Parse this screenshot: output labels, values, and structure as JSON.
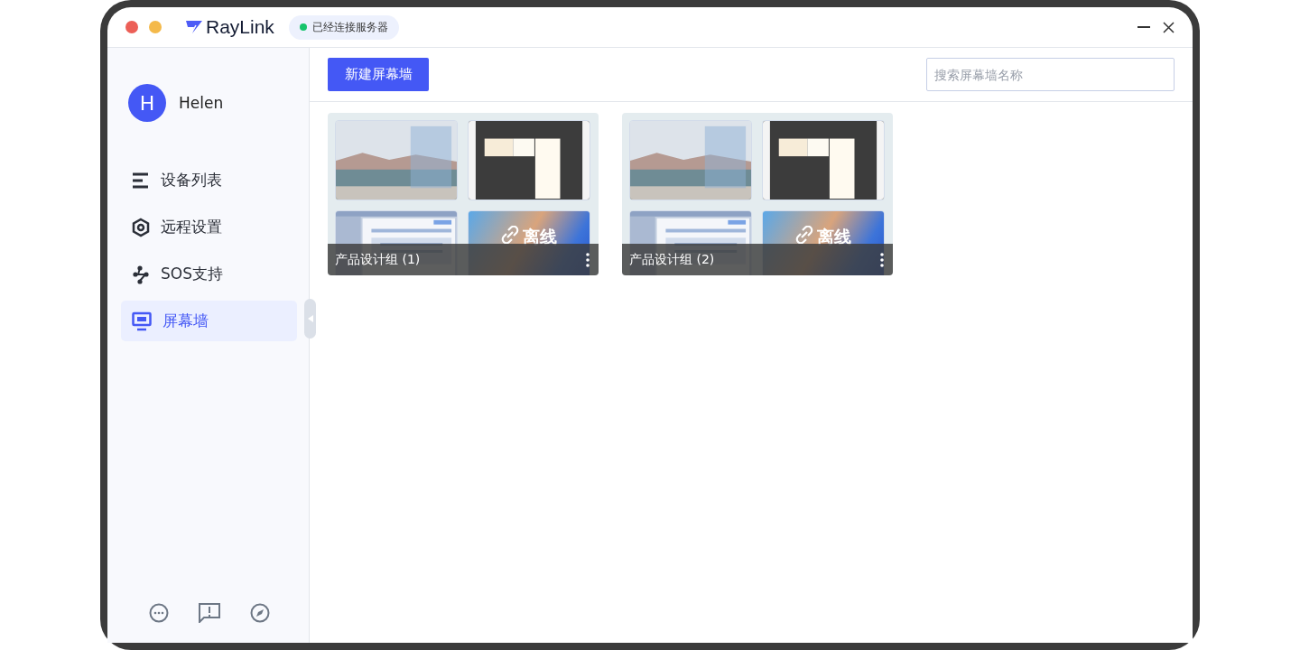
{
  "window": {
    "brand": "RayLink",
    "status": {
      "label": "已经连接服务器",
      "connected": true
    }
  },
  "user": {
    "initial": "H",
    "name": "Helen"
  },
  "nav": [
    {
      "kind": "list",
      "label": "设备列表",
      "selected": false
    },
    {
      "kind": "settings",
      "label": "远程设置",
      "selected": false
    },
    {
      "kind": "sos",
      "label": "SOS支持",
      "selected": false
    },
    {
      "kind": "wall",
      "label": "屏幕墙",
      "selected": true
    }
  ],
  "toolbar": {
    "new_button": "新建屏幕墙",
    "search": {
      "placeholder": "搜索屏幕墙名称"
    }
  },
  "walls": [
    {
      "name": "产品设计组 (1)",
      "tiles": [
        {
          "kind": "picture"
        },
        {
          "kind": "picture"
        },
        {
          "kind": "picture"
        },
        {
          "kind": "offline",
          "label": "离线"
        }
      ]
    },
    {
      "name": "产品设计组 (2)",
      "tiles": [
        {
          "kind": "picture"
        },
        {
          "kind": "picture"
        },
        {
          "kind": "picture"
        },
        {
          "kind": "offline",
          "label": "离线"
        }
      ]
    }
  ]
}
